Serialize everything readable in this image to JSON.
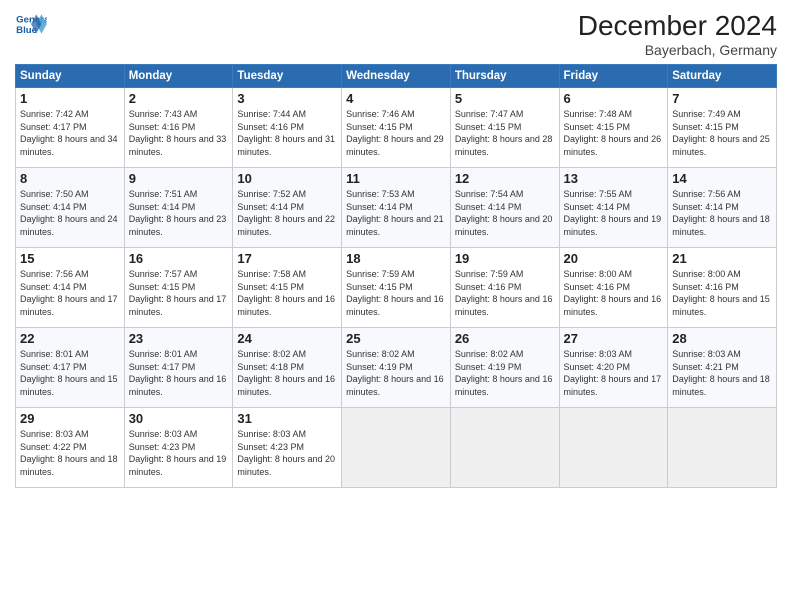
{
  "header": {
    "logo_line1": "General",
    "logo_line2": "Blue",
    "month_title": "December 2024",
    "location": "Bayerbach, Germany"
  },
  "weekdays": [
    "Sunday",
    "Monday",
    "Tuesday",
    "Wednesday",
    "Thursday",
    "Friday",
    "Saturday"
  ],
  "weeks": [
    [
      {
        "day": "1",
        "sunrise": "7:42 AM",
        "sunset": "4:17 PM",
        "daylight": "8 hours and 34 minutes."
      },
      {
        "day": "2",
        "sunrise": "7:43 AM",
        "sunset": "4:16 PM",
        "daylight": "8 hours and 33 minutes."
      },
      {
        "day": "3",
        "sunrise": "7:44 AM",
        "sunset": "4:16 PM",
        "daylight": "8 hours and 31 minutes."
      },
      {
        "day": "4",
        "sunrise": "7:46 AM",
        "sunset": "4:15 PM",
        "daylight": "8 hours and 29 minutes."
      },
      {
        "day": "5",
        "sunrise": "7:47 AM",
        "sunset": "4:15 PM",
        "daylight": "8 hours and 28 minutes."
      },
      {
        "day": "6",
        "sunrise": "7:48 AM",
        "sunset": "4:15 PM",
        "daylight": "8 hours and 26 minutes."
      },
      {
        "day": "7",
        "sunrise": "7:49 AM",
        "sunset": "4:15 PM",
        "daylight": "8 hours and 25 minutes."
      }
    ],
    [
      {
        "day": "8",
        "sunrise": "7:50 AM",
        "sunset": "4:14 PM",
        "daylight": "8 hours and 24 minutes."
      },
      {
        "day": "9",
        "sunrise": "7:51 AM",
        "sunset": "4:14 PM",
        "daylight": "8 hours and 23 minutes."
      },
      {
        "day": "10",
        "sunrise": "7:52 AM",
        "sunset": "4:14 PM",
        "daylight": "8 hours and 22 minutes."
      },
      {
        "day": "11",
        "sunrise": "7:53 AM",
        "sunset": "4:14 PM",
        "daylight": "8 hours and 21 minutes."
      },
      {
        "day": "12",
        "sunrise": "7:54 AM",
        "sunset": "4:14 PM",
        "daylight": "8 hours and 20 minutes."
      },
      {
        "day": "13",
        "sunrise": "7:55 AM",
        "sunset": "4:14 PM",
        "daylight": "8 hours and 19 minutes."
      },
      {
        "day": "14",
        "sunrise": "7:56 AM",
        "sunset": "4:14 PM",
        "daylight": "8 hours and 18 minutes."
      }
    ],
    [
      {
        "day": "15",
        "sunrise": "7:56 AM",
        "sunset": "4:14 PM",
        "daylight": "8 hours and 17 minutes."
      },
      {
        "day": "16",
        "sunrise": "7:57 AM",
        "sunset": "4:15 PM",
        "daylight": "8 hours and 17 minutes."
      },
      {
        "day": "17",
        "sunrise": "7:58 AM",
        "sunset": "4:15 PM",
        "daylight": "8 hours and 16 minutes."
      },
      {
        "day": "18",
        "sunrise": "7:59 AM",
        "sunset": "4:15 PM",
        "daylight": "8 hours and 16 minutes."
      },
      {
        "day": "19",
        "sunrise": "7:59 AM",
        "sunset": "4:16 PM",
        "daylight": "8 hours and 16 minutes."
      },
      {
        "day": "20",
        "sunrise": "8:00 AM",
        "sunset": "4:16 PM",
        "daylight": "8 hours and 16 minutes."
      },
      {
        "day": "21",
        "sunrise": "8:00 AM",
        "sunset": "4:16 PM",
        "daylight": "8 hours and 15 minutes."
      }
    ],
    [
      {
        "day": "22",
        "sunrise": "8:01 AM",
        "sunset": "4:17 PM",
        "daylight": "8 hours and 15 minutes."
      },
      {
        "day": "23",
        "sunrise": "8:01 AM",
        "sunset": "4:17 PM",
        "daylight": "8 hours and 16 minutes."
      },
      {
        "day": "24",
        "sunrise": "8:02 AM",
        "sunset": "4:18 PM",
        "daylight": "8 hours and 16 minutes."
      },
      {
        "day": "25",
        "sunrise": "8:02 AM",
        "sunset": "4:19 PM",
        "daylight": "8 hours and 16 minutes."
      },
      {
        "day": "26",
        "sunrise": "8:02 AM",
        "sunset": "4:19 PM",
        "daylight": "8 hours and 16 minutes."
      },
      {
        "day": "27",
        "sunrise": "8:03 AM",
        "sunset": "4:20 PM",
        "daylight": "8 hours and 17 minutes."
      },
      {
        "day": "28",
        "sunrise": "8:03 AM",
        "sunset": "4:21 PM",
        "daylight": "8 hours and 18 minutes."
      }
    ],
    [
      {
        "day": "29",
        "sunrise": "8:03 AM",
        "sunset": "4:22 PM",
        "daylight": "8 hours and 18 minutes."
      },
      {
        "day": "30",
        "sunrise": "8:03 AM",
        "sunset": "4:23 PM",
        "daylight": "8 hours and 19 minutes."
      },
      {
        "day": "31",
        "sunrise": "8:03 AM",
        "sunset": "4:23 PM",
        "daylight": "8 hours and 20 minutes."
      },
      null,
      null,
      null,
      null
    ]
  ]
}
